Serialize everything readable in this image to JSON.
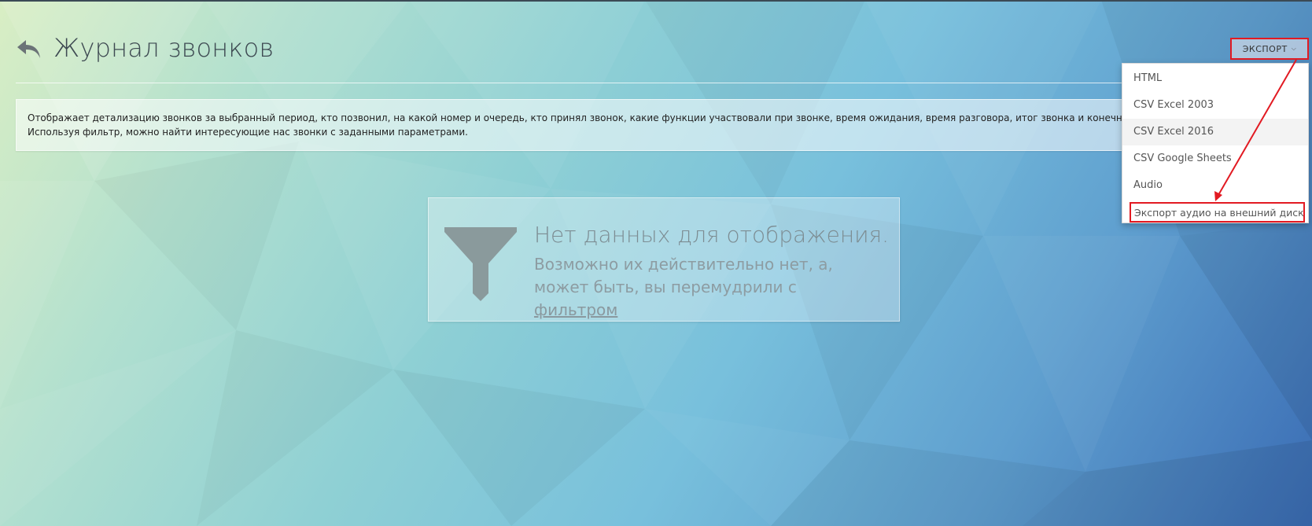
{
  "header": {
    "title": "Журнал звонков"
  },
  "info": {
    "line1": "Отображает детализацию звонков за выбранный период, кто позвонил, на какой номер и очередь, кто принял звонок, какие функции участвовали при звонке, время ожидания, время разговора, итог звонка и конечн",
    "line2": "Используя фильтр, можно найти интересующие нас звонки с заданными параметрами."
  },
  "toolbar": {
    "export_label": "ЭКСПОРТ",
    "export_chevron": "⌵"
  },
  "export_menu": {
    "items": [
      {
        "label": "HTML"
      },
      {
        "label": "CSV Excel 2003"
      },
      {
        "label": "CSV Excel 2016"
      },
      {
        "label": "CSV Google Sheets"
      },
      {
        "label": "Audio"
      },
      {
        "label": "Экспорт аудио на внешний диск"
      }
    ]
  },
  "empty_state": {
    "title": "Нет данных для отображения.",
    "subtitle_before_link": "Возможно их действительно нет, а, может быть, вы перемудрили с ",
    "link_text": "фильтром"
  },
  "colors": {
    "annotation": "#e21a22",
    "title_text": "#3e4a52",
    "filter_icon": "#8a9a9c"
  },
  "icons": {
    "back": "back-arrow-icon",
    "filter": "filter-icon",
    "chevron": "chevron-down-icon"
  }
}
